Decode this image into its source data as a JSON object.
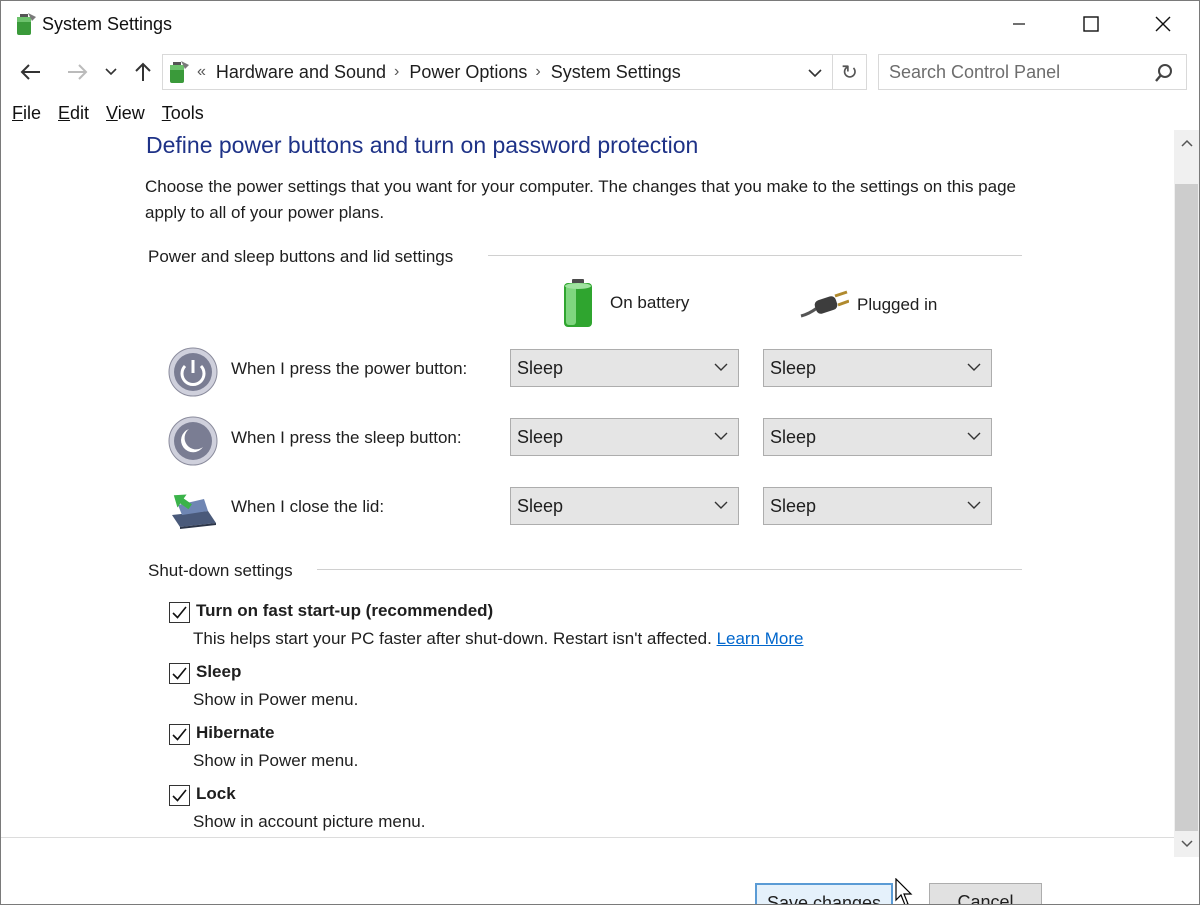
{
  "window": {
    "title": "System Settings",
    "minimize_glyph": "—",
    "maximize_glyph": "☐",
    "close_glyph": "✕"
  },
  "nav": {
    "back_glyph": "←",
    "forward_glyph": "→",
    "recent_glyph": "⌄",
    "up_glyph": "↑",
    "overflow_glyph": "«",
    "breadcrumbs": [
      "Hardware and Sound",
      "Power Options",
      "System Settings"
    ],
    "separator": "›",
    "refresh_glyph": "↻",
    "search_placeholder": "Search Control Panel"
  },
  "menu": {
    "items": [
      {
        "underline": "F",
        "rest": "ile"
      },
      {
        "underline": "E",
        "rest": "dit"
      },
      {
        "underline": "V",
        "rest": "iew"
      },
      {
        "underline": "T",
        "rest": "ools"
      }
    ]
  },
  "page": {
    "title": "Define power buttons and turn on password protection",
    "intro": "Choose the power settings that you want for your computer. The changes that you make to the settings on this page apply to all of your power plans.",
    "power_section": {
      "heading": "Power and sleep buttons and lid settings",
      "col_battery": "On battery",
      "col_plugged": "Plugged in",
      "rows": [
        {
          "label": "When I press the power button:",
          "battery": "Sleep",
          "plugged": "Sleep"
        },
        {
          "label": "When I press the sleep button:",
          "battery": "Sleep",
          "plugged": "Sleep"
        },
        {
          "label": "When I close the lid:",
          "battery": "Sleep",
          "plugged": "Sleep"
        }
      ]
    },
    "shutdown_section": {
      "heading": "Shut-down settings",
      "options": [
        {
          "label": "Turn on fast start-up (recommended)",
          "desc": "This helps start your PC faster after shut-down. Restart isn't affected.",
          "link": "Learn More",
          "checked": true
        },
        {
          "label": "Sleep",
          "desc": "Show in Power menu.",
          "checked": true
        },
        {
          "label": "Hibernate",
          "desc": "Show in Power menu.",
          "checked": true
        },
        {
          "label": "Lock",
          "desc": "Show in account picture menu.",
          "checked": true
        }
      ]
    }
  },
  "footer": {
    "save_label": "Save changes",
    "cancel_label": "Cancel"
  },
  "colors": {
    "title_blue": "#1e3287",
    "link_blue": "#0066cc",
    "button_focus": "#5a9bd5"
  }
}
